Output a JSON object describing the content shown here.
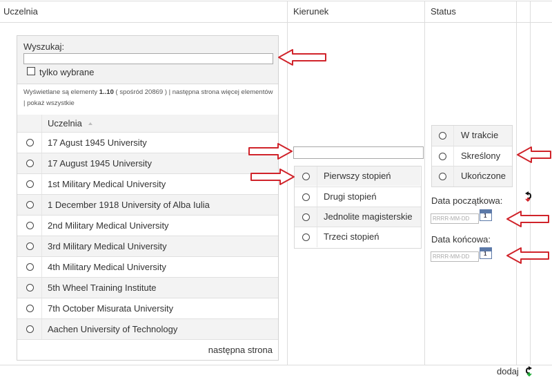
{
  "columns": {
    "uczelnia": "Uczelnia",
    "kierunek": "Kierunek",
    "status": "Status"
  },
  "search": {
    "label": "Wyszukaj:",
    "value": "",
    "only_selected_label": "tylko wybrane",
    "info_prefix": "Wyświetlane są elementy ",
    "info_range": "1..10",
    "info_rest": " ( spośród 20869 ) | następna strona więcej elementów | pokaż wszystkie"
  },
  "table": {
    "header": "Uczelnia",
    "rows": [
      "17 Agust 1945 University",
      "17 August 1945 University",
      "1st Military Medical University",
      "1 December 1918 University of Alba Iulia",
      "2nd Military Medical University",
      "3rd Military Medical University",
      "4th Military Medical University",
      "5th Wheel Training Institute",
      "7th October Misurata University",
      "Aachen University of Technology"
    ],
    "next_page": "następna strona"
  },
  "kierunek": {
    "value": "",
    "levels": [
      "Pierwszy stopień",
      "Drugi stopień",
      "Jednolite magisterskie",
      "Trzeci stopień"
    ]
  },
  "status": {
    "options": [
      "W trakcie",
      "Skreślony",
      "Ukończone"
    ],
    "start_label": "Data początkowa:",
    "end_label": "Data końcowa:",
    "date_placeholder": "RRRR-MM-DD",
    "calendar_day": "1"
  },
  "footer": {
    "add_label": "dodaj"
  },
  "colors": {
    "annotation_arrow": "#d0232a",
    "undo_icon": "#d0232a",
    "calendar": "#5c79a8"
  }
}
